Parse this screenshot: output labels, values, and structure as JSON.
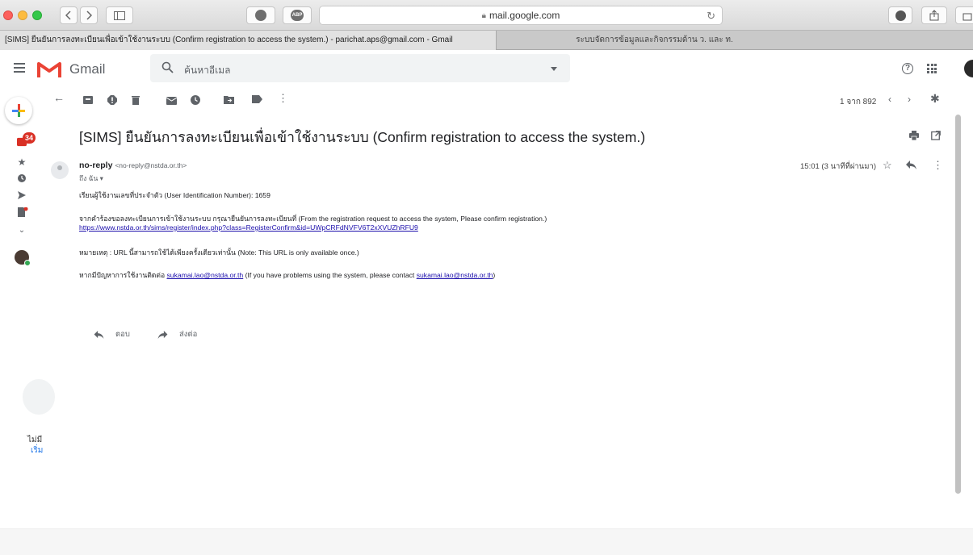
{
  "browser": {
    "address": "mail.google.com",
    "pin_badge": "ABP"
  },
  "tabs": [
    {
      "label": "[SIMS] ยืนยันการลงทะเบียนเพื่อเข้าใช้งานระบบ (Confirm registration to access the system.) - parichat.aps@gmail.com - Gmail"
    },
    {
      "label": "ระบบจัดการข้อมูลและกิจกรรมด้าน ว. และ ท."
    }
  ],
  "header": {
    "app_name": "Gmail",
    "search_placeholder": "ค้นหาอีเมล",
    "help_glyph": "?"
  },
  "rail": {
    "inbox_count": "34",
    "bottom_text_1": "ไม่มี",
    "bottom_text_2": "เริ่ม"
  },
  "toolbar": {
    "pager": "1 จาก 892"
  },
  "email": {
    "subject": "[SIMS] ยืนยันการลงทะเบียนเพื่อเข้าใช้งานระบบ (Confirm registration to access the system.)",
    "sender_name": "no-reply",
    "sender_email": "<no-reply@nstda.or.th>",
    "to": "ถึง ฉัน ▾",
    "time": "15:01 (3 นาทีที่ผ่านมา)",
    "body": {
      "line1": "เรียนผู้ใช้งานเลขที่ประจำตัว (User Identification Number): 1659",
      "line2": "จากคำร้องขอลงทะเบียนการเข้าใช้งานระบบ กรุณายืนยันการลงทะเบียนที่ (From the registration request to access the system, Please confirm registration.)",
      "link": "https://www.nstda.or.th/sims/register/index.php?class=RegisterConfirm&id=UWpCRFdNVFV6T2xXVUZhRFU9",
      "note": "หมายเหตุ : URL นี้สามารถใช้ได้เพียงครั้งเดียวเท่านั้น (Note: This URL is only available once.)",
      "contact_prefix": "หากมีปัญหาการใช้งานติดต่อ",
      "contact_email": "sukamai.lao@nstda.or.th",
      "contact_mid": "(If you have problems using the system, please contact",
      "contact_email2": "sukamai.lao@nstda.or.th",
      "contact_end": ")"
    },
    "reply_label": "ตอบ",
    "forward_label": "ส่งต่อ"
  },
  "colors": {
    "gmail_red": "#ea4335",
    "badge": "#d93025",
    "link": "#1a0dab"
  }
}
